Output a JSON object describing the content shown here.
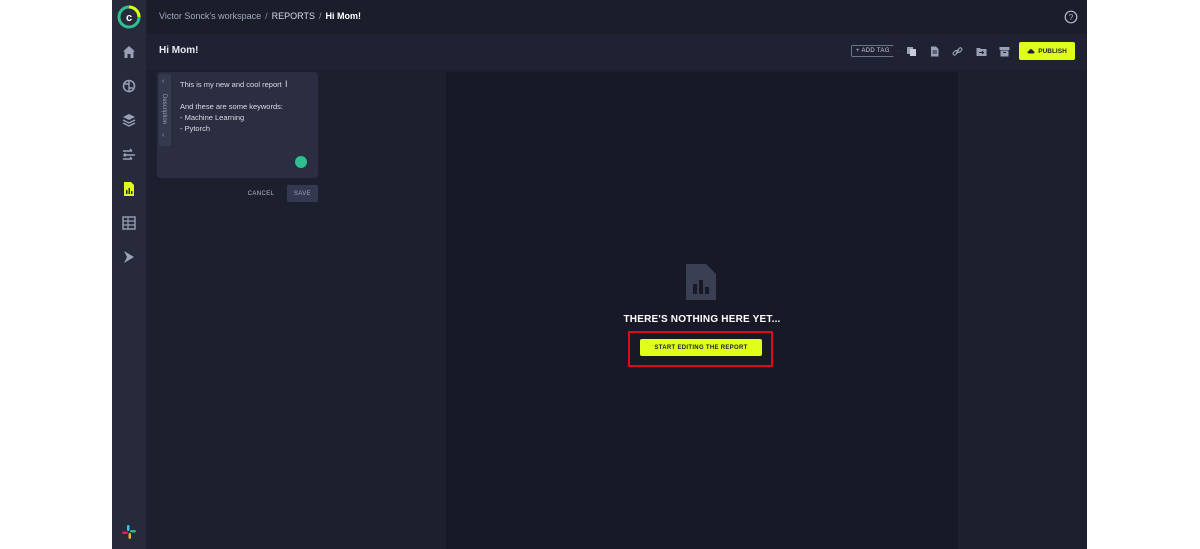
{
  "breadcrumb": {
    "workspace": "Victor Sonck's workspace",
    "section": "REPORTS",
    "current": "Hi Mom!"
  },
  "page": {
    "title": "Hi Mom!"
  },
  "toolbar": {
    "add_tag_label": "+ ADD TAG",
    "publish_label": "PUBLISH"
  },
  "description": {
    "tab_label": "Description",
    "lines": [
      "This is my new and cool report",
      "",
      "And these are some keywords:",
      "- Machine Learning",
      "- Pytorch"
    ],
    "cancel_label": "CANCEL",
    "save_label": "SAVE"
  },
  "empty_state": {
    "title": "THERE'S NOTHING HERE YET...",
    "button_label": "START EDITING THE REPORT"
  },
  "colors": {
    "accent": "#dfff1a",
    "background": "#1c1f2e",
    "highlight": "#e00a1a"
  },
  "icons": [
    "logo-icon",
    "home-icon",
    "brain-icon",
    "layers-icon",
    "pipelines-icon",
    "reports-icon",
    "datasets-icon",
    "deploy-icon",
    "help-icon",
    "user-icon",
    "slack-icon"
  ]
}
